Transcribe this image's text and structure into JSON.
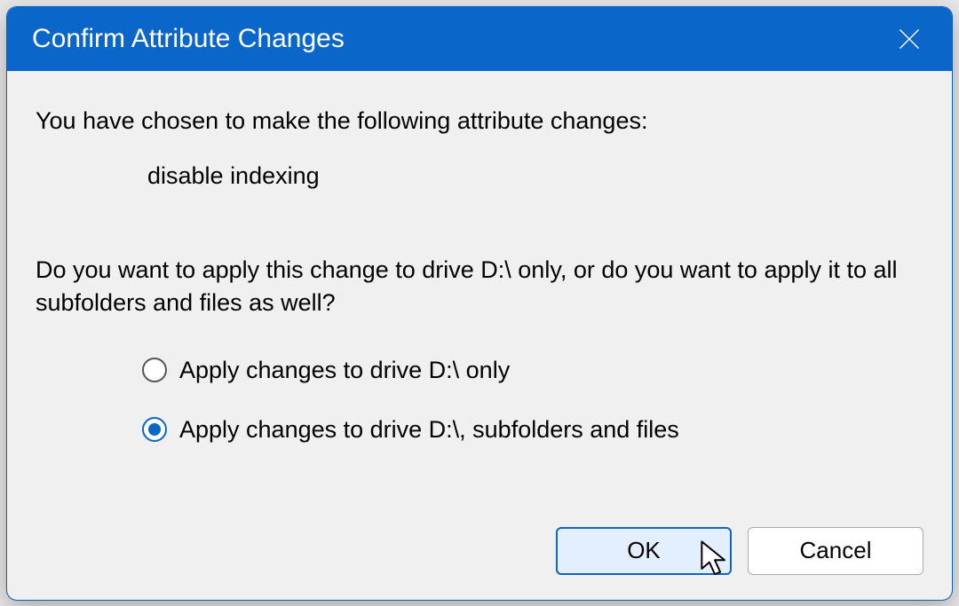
{
  "titlebar": {
    "title": "Confirm Attribute Changes"
  },
  "content": {
    "intro": "You have chosen to make the following attribute changes:",
    "change_item": "disable indexing",
    "question": "Do you want to apply this change to drive D:\\ only, or do you want to apply it to all subfolders and files as well?",
    "options": {
      "drive_only": "Apply changes to drive D:\\ only",
      "recursive": "Apply changes to drive D:\\, subfolders and files"
    }
  },
  "buttons": {
    "ok": "OK",
    "cancel": "Cancel"
  }
}
